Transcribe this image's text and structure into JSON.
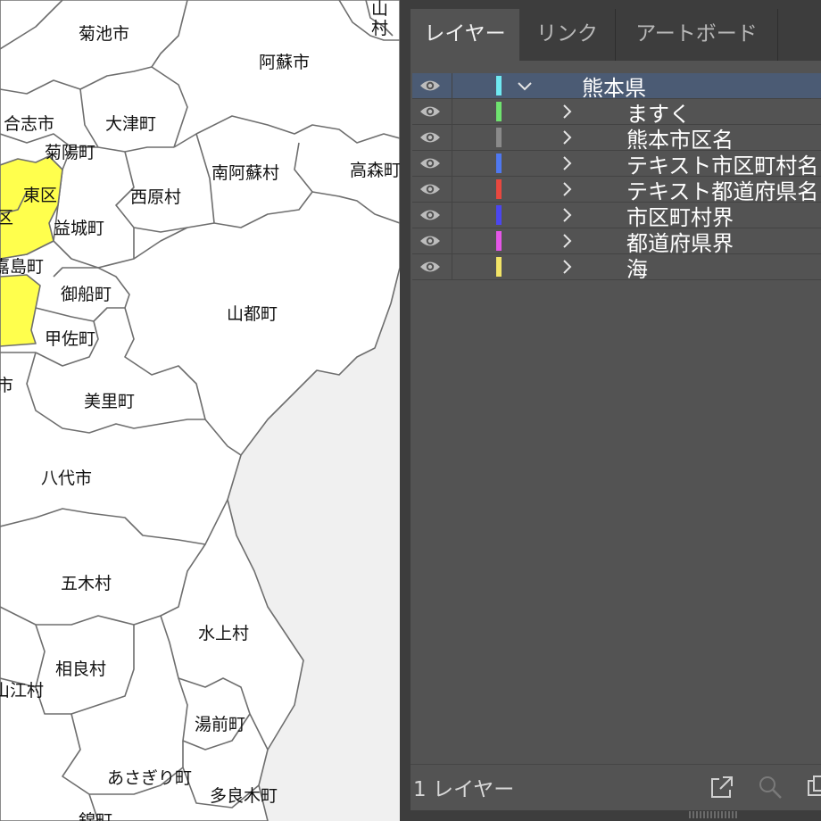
{
  "map": {
    "municipalities": [
      {
        "id": "kikuchi",
        "label": "菊池市",
        "highlight": false
      },
      {
        "id": "aso",
        "label": "阿蘇市",
        "highlight": false
      },
      {
        "id": "koshi",
        "label": "合志市",
        "highlight": false
      },
      {
        "id": "otsu",
        "label": "大津町",
        "highlight": false
      },
      {
        "id": "kikuyo",
        "label": "菊陽町",
        "highlight": false
      },
      {
        "id": "higashiku",
        "label": "東区",
        "highlight": true
      },
      {
        "id": "ku-partial",
        "label": "区",
        "highlight": true
      },
      {
        "id": "nishihara",
        "label": "西原村",
        "highlight": false
      },
      {
        "id": "minamiaso",
        "label": "南阿蘇村",
        "highlight": false
      },
      {
        "id": "takamori",
        "label": "高森町",
        "highlight": false
      },
      {
        "id": "mashiki",
        "label": "益城町",
        "highlight": false
      },
      {
        "id": "kashima",
        "label": "嘉島町",
        "highlight": false
      },
      {
        "id": "mifune",
        "label": "御船町",
        "highlight": false
      },
      {
        "id": "yamato",
        "label": "山都町",
        "highlight": false
      },
      {
        "id": "kosa",
        "label": "甲佐町",
        "highlight": false
      },
      {
        "id": "shi-partial",
        "label": "市",
        "highlight": false
      },
      {
        "id": "misato",
        "label": "美里町",
        "highlight": false
      },
      {
        "id": "yatsushiro",
        "label": "八代市",
        "highlight": false
      },
      {
        "id": "itsuki",
        "label": "五木村",
        "highlight": false
      },
      {
        "id": "mizukami",
        "label": "水上村",
        "highlight": false
      },
      {
        "id": "yamae",
        "label": "山江村",
        "highlight": false
      },
      {
        "id": "sagara",
        "label": "相良村",
        "highlight": false
      },
      {
        "id": "yunomae",
        "label": "湯前町",
        "highlight": false
      },
      {
        "id": "asagiri",
        "label": "あさぎり町",
        "highlight": false
      },
      {
        "id": "taragi",
        "label": "多良木町",
        "highlight": false
      },
      {
        "id": "nishiki",
        "label": "錦町",
        "highlight": false
      },
      {
        "id": "yamaga-partial",
        "label": "山",
        "highlight": false
      },
      {
        "id": "mura-partial",
        "label": "村",
        "highlight": false
      }
    ],
    "colors": {
      "land": "#ffffff",
      "sea": "#f0f0f0",
      "highlight": "#ffff4d",
      "border": "#6e6e6e"
    }
  },
  "panel": {
    "tabs": [
      {
        "label": "レイヤー",
        "active": true
      },
      {
        "label": "リンク",
        "active": false
      },
      {
        "label": "アートボード",
        "active": false
      }
    ],
    "layers": [
      {
        "name": "熊本県",
        "color": "#6fe9f2",
        "expanded": true,
        "selected": true,
        "level": 0,
        "eye_icon": "eye-icon",
        "chevron": "chevron-down-icon"
      },
      {
        "name": "ますく",
        "color": "#6fe36f",
        "expanded": false,
        "selected": false,
        "level": 1,
        "eye_icon": "eye-icon",
        "chevron": "chevron-right-icon"
      },
      {
        "name": "熊本市区名",
        "color": "#8a8a8a",
        "expanded": false,
        "selected": false,
        "level": 1,
        "eye_icon": "eye-icon",
        "chevron": "chevron-right-icon"
      },
      {
        "name": "テキスト市区町村名",
        "color": "#4f78f0",
        "expanded": false,
        "selected": false,
        "level": 1,
        "eye_icon": "eye-icon",
        "chevron": "chevron-right-icon"
      },
      {
        "name": "テキスト都道府県名",
        "color": "#e8483f",
        "expanded": false,
        "selected": false,
        "level": 1,
        "eye_icon": "eye-icon",
        "chevron": "chevron-right-icon"
      },
      {
        "name": "市区町村界",
        "color": "#4b46f0",
        "expanded": false,
        "selected": false,
        "level": 1,
        "eye_icon": "eye-icon",
        "chevron": "chevron-right-icon"
      },
      {
        "name": "都道府県界",
        "color": "#e556e8",
        "expanded": false,
        "selected": false,
        "level": 1,
        "eye_icon": "eye-icon",
        "chevron": "chevron-right-icon"
      },
      {
        "name": "海",
        "color": "#f2e467",
        "expanded": false,
        "selected": false,
        "level": 1,
        "eye_icon": "eye-icon",
        "chevron": "chevron-right-icon"
      }
    ],
    "footer": {
      "layer_count": "1 レイヤー",
      "icons": [
        "export-icon",
        "search-icon",
        "new-layer-icon"
      ]
    },
    "colors": {
      "panel_bg": "#535353",
      "tab_bar": "#3d3d3d",
      "selected_row": "#4b5b74",
      "text": "#ffffff"
    }
  }
}
